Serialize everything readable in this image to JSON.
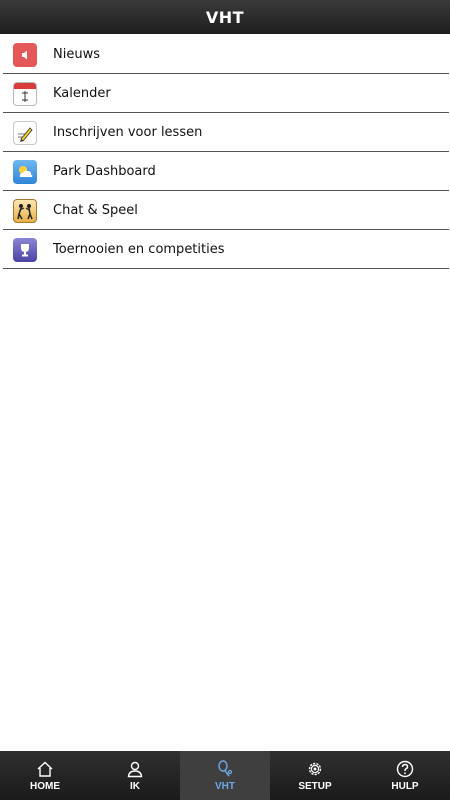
{
  "header": {
    "title": "VHT"
  },
  "menu": {
    "items": [
      {
        "label": "Nieuws",
        "icon": "speaker-icon"
      },
      {
        "label": "Kalender",
        "icon": "calendar-icon"
      },
      {
        "label": "Inschrijven voor lessen",
        "icon": "pencil-note-icon"
      },
      {
        "label": "Park Dashboard",
        "icon": "weather-cloud-icon"
      },
      {
        "label": "Chat & Speel",
        "icon": "tennis-players-icon"
      },
      {
        "label": "Toernooien en competities",
        "icon": "trophy-icon"
      }
    ]
  },
  "tabbar": {
    "tabs": [
      {
        "label": "HOME",
        "icon": "home-icon",
        "active": false
      },
      {
        "label": "IK",
        "icon": "person-icon",
        "active": false
      },
      {
        "label": "VHT",
        "icon": "tennis-racket-icon",
        "active": true
      },
      {
        "label": "SETUP",
        "icon": "gear-icon",
        "active": false
      },
      {
        "label": "HULP",
        "icon": "help-icon",
        "active": false
      }
    ]
  },
  "colors": {
    "header_bg": "#2a2a2a",
    "tabbar_bg": "#232323",
    "active_tab_label": "#6fa8e6",
    "divider": "#555555"
  }
}
